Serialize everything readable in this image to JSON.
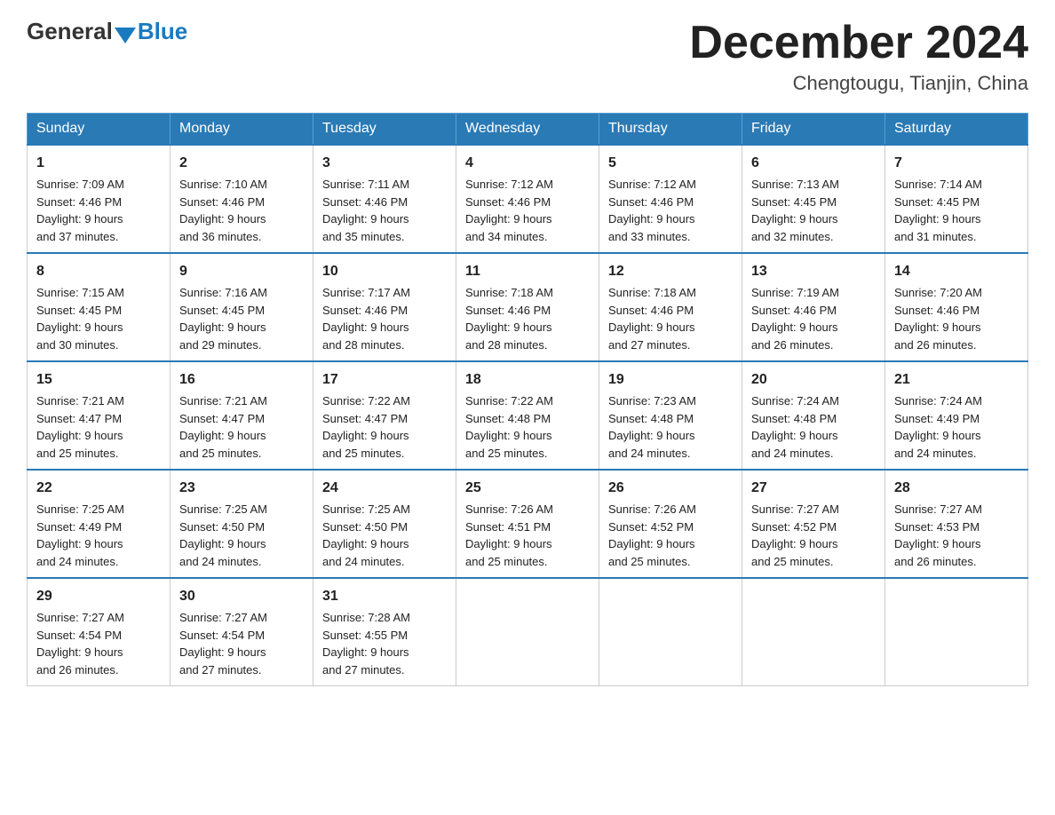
{
  "header": {
    "logo_general": "General",
    "logo_blue": "Blue",
    "month_title": "December 2024",
    "location": "Chengtougu, Tianjin, China"
  },
  "days_of_week": [
    "Sunday",
    "Monday",
    "Tuesday",
    "Wednesday",
    "Thursday",
    "Friday",
    "Saturday"
  ],
  "weeks": [
    [
      {
        "day": "1",
        "sunrise": "7:09 AM",
        "sunset": "4:46 PM",
        "daylight": "9 hours and 37 minutes."
      },
      {
        "day": "2",
        "sunrise": "7:10 AM",
        "sunset": "4:46 PM",
        "daylight": "9 hours and 36 minutes."
      },
      {
        "day": "3",
        "sunrise": "7:11 AM",
        "sunset": "4:46 PM",
        "daylight": "9 hours and 35 minutes."
      },
      {
        "day": "4",
        "sunrise": "7:12 AM",
        "sunset": "4:46 PM",
        "daylight": "9 hours and 34 minutes."
      },
      {
        "day": "5",
        "sunrise": "7:12 AM",
        "sunset": "4:46 PM",
        "daylight": "9 hours and 33 minutes."
      },
      {
        "day": "6",
        "sunrise": "7:13 AM",
        "sunset": "4:45 PM",
        "daylight": "9 hours and 32 minutes."
      },
      {
        "day": "7",
        "sunrise": "7:14 AM",
        "sunset": "4:45 PM",
        "daylight": "9 hours and 31 minutes."
      }
    ],
    [
      {
        "day": "8",
        "sunrise": "7:15 AM",
        "sunset": "4:45 PM",
        "daylight": "9 hours and 30 minutes."
      },
      {
        "day": "9",
        "sunrise": "7:16 AM",
        "sunset": "4:45 PM",
        "daylight": "9 hours and 29 minutes."
      },
      {
        "day": "10",
        "sunrise": "7:17 AM",
        "sunset": "4:46 PM",
        "daylight": "9 hours and 28 minutes."
      },
      {
        "day": "11",
        "sunrise": "7:18 AM",
        "sunset": "4:46 PM",
        "daylight": "9 hours and 28 minutes."
      },
      {
        "day": "12",
        "sunrise": "7:18 AM",
        "sunset": "4:46 PM",
        "daylight": "9 hours and 27 minutes."
      },
      {
        "day": "13",
        "sunrise": "7:19 AM",
        "sunset": "4:46 PM",
        "daylight": "9 hours and 26 minutes."
      },
      {
        "day": "14",
        "sunrise": "7:20 AM",
        "sunset": "4:46 PM",
        "daylight": "9 hours and 26 minutes."
      }
    ],
    [
      {
        "day": "15",
        "sunrise": "7:21 AM",
        "sunset": "4:47 PM",
        "daylight": "9 hours and 25 minutes."
      },
      {
        "day": "16",
        "sunrise": "7:21 AM",
        "sunset": "4:47 PM",
        "daylight": "9 hours and 25 minutes."
      },
      {
        "day": "17",
        "sunrise": "7:22 AM",
        "sunset": "4:47 PM",
        "daylight": "9 hours and 25 minutes."
      },
      {
        "day": "18",
        "sunrise": "7:22 AM",
        "sunset": "4:48 PM",
        "daylight": "9 hours and 25 minutes."
      },
      {
        "day": "19",
        "sunrise": "7:23 AM",
        "sunset": "4:48 PM",
        "daylight": "9 hours and 24 minutes."
      },
      {
        "day": "20",
        "sunrise": "7:24 AM",
        "sunset": "4:48 PM",
        "daylight": "9 hours and 24 minutes."
      },
      {
        "day": "21",
        "sunrise": "7:24 AM",
        "sunset": "4:49 PM",
        "daylight": "9 hours and 24 minutes."
      }
    ],
    [
      {
        "day": "22",
        "sunrise": "7:25 AM",
        "sunset": "4:49 PM",
        "daylight": "9 hours and 24 minutes."
      },
      {
        "day": "23",
        "sunrise": "7:25 AM",
        "sunset": "4:50 PM",
        "daylight": "9 hours and 24 minutes."
      },
      {
        "day": "24",
        "sunrise": "7:25 AM",
        "sunset": "4:50 PM",
        "daylight": "9 hours and 24 minutes."
      },
      {
        "day": "25",
        "sunrise": "7:26 AM",
        "sunset": "4:51 PM",
        "daylight": "9 hours and 25 minutes."
      },
      {
        "day": "26",
        "sunrise": "7:26 AM",
        "sunset": "4:52 PM",
        "daylight": "9 hours and 25 minutes."
      },
      {
        "day": "27",
        "sunrise": "7:27 AM",
        "sunset": "4:52 PM",
        "daylight": "9 hours and 25 minutes."
      },
      {
        "day": "28",
        "sunrise": "7:27 AM",
        "sunset": "4:53 PM",
        "daylight": "9 hours and 26 minutes."
      }
    ],
    [
      {
        "day": "29",
        "sunrise": "7:27 AM",
        "sunset": "4:54 PM",
        "daylight": "9 hours and 26 minutes."
      },
      {
        "day": "30",
        "sunrise": "7:27 AM",
        "sunset": "4:54 PM",
        "daylight": "9 hours and 27 minutes."
      },
      {
        "day": "31",
        "sunrise": "7:28 AM",
        "sunset": "4:55 PM",
        "daylight": "9 hours and 27 minutes."
      },
      null,
      null,
      null,
      null
    ]
  ],
  "labels": {
    "sunrise": "Sunrise:",
    "sunset": "Sunset:",
    "daylight": "Daylight:"
  }
}
